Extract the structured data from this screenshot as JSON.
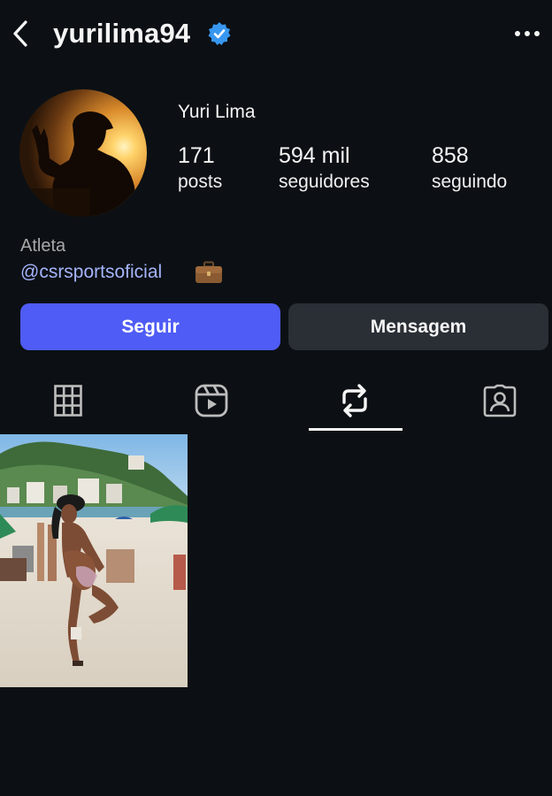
{
  "header": {
    "username": "yurilima94",
    "verified_icon": "verified-badge-icon",
    "back_icon": "chevron-left-icon",
    "more_icon": "more-horizontal-icon"
  },
  "profile": {
    "display_name": "Yuri Lima",
    "stats": {
      "posts_count": "171",
      "posts_label": "posts",
      "followers_count": "594 mil",
      "followers_label": "seguidores",
      "following_count": "858",
      "following_label": "seguindo"
    },
    "bio": {
      "category": "Atleta",
      "link": "@csrsportsoficial",
      "emoji_icon": "briefcase-icon"
    }
  },
  "actions": {
    "follow_label": "Seguir",
    "message_label": "Mensagem"
  },
  "tabs": [
    {
      "icon": "grid-icon",
      "active": false
    },
    {
      "icon": "reels-icon",
      "active": false
    },
    {
      "icon": "reposts-icon",
      "active": true
    },
    {
      "icon": "tagged-icon",
      "active": false
    }
  ],
  "colors": {
    "background": "#0c1014",
    "accent": "#4f5cf5",
    "link": "#a5b4fc",
    "verified": "#3897f0",
    "secondary_button": "#2a2e35"
  },
  "posts": [
    {
      "type": "photo",
      "subject": "beach-photo"
    }
  ]
}
